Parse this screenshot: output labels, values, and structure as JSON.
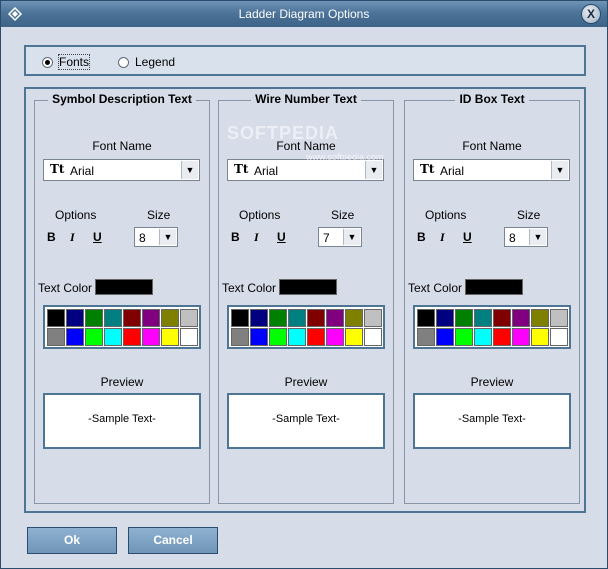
{
  "window": {
    "title": "Ladder Diagram Options",
    "close_label": "X"
  },
  "mode": {
    "fonts_label": "Fonts",
    "legend_label": "Legend",
    "selected": "fonts"
  },
  "groups": [
    {
      "title": "Symbol Description Text",
      "font_name_label": "Font Name",
      "font_icon": "Tt",
      "font_value": "Arial",
      "options_label": "Options",
      "size_label": "Size",
      "size_value": "8",
      "bold": "B",
      "italic": "I",
      "underline": "U",
      "text_color_label": "Text Color",
      "preview_label": "Preview",
      "preview_text": "-Sample Text-",
      "text_color": "#000000"
    },
    {
      "title": "Wire Number Text",
      "font_name_label": "Font Name",
      "font_icon": "Tt",
      "font_value": "Arial",
      "options_label": "Options",
      "size_label": "Size",
      "size_value": "7",
      "bold": "B",
      "italic": "I",
      "underline": "U",
      "text_color_label": "Text Color",
      "preview_label": "Preview",
      "preview_text": "-Sample Text-",
      "text_color": "#000000"
    },
    {
      "title": "ID Box Text",
      "font_name_label": "Font Name",
      "font_icon": "Tt",
      "font_value": "Arial",
      "options_label": "Options",
      "size_label": "Size",
      "size_value": "8",
      "bold": "B",
      "italic": "I",
      "underline": "U",
      "text_color_label": "Text Color",
      "preview_label": "Preview",
      "preview_text": "-Sample Text-",
      "text_color": "#000000"
    }
  ],
  "palette": [
    "#000000",
    "#000080",
    "#008000",
    "#008080",
    "#800000",
    "#800080",
    "#808000",
    "#c0c0c0",
    "#808080",
    "#0000ff",
    "#00ff00",
    "#00ffff",
    "#ff0000",
    "#ff00ff",
    "#ffff00",
    "#ffffff"
  ],
  "buttons": {
    "ok": "Ok",
    "cancel": "Cancel"
  },
  "watermark": {
    "text": "SOFTPEDIA",
    "url": "www.softpedia.com"
  }
}
